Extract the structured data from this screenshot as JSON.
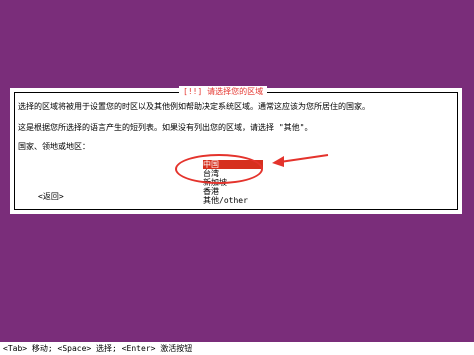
{
  "dialog": {
    "title": "[!!] 请选择您的区域",
    "description_line1": "选择的区域将被用于设置您的时区以及其他例如帮助决定系统区域。通常这应该为您所居住的国家。",
    "description_line2": "这是根据您所选择的语言产生的短列表。如果没有列出您的区域，请选择 \"其他\"。",
    "field_label": "国家、领地或地区：",
    "options": [
      "中国",
      "台湾",
      "新加坡",
      "香港",
      "其他/other"
    ],
    "selected_option": "中国",
    "back_label": "<返回>"
  },
  "statusbar": {
    "text": "<Tab> 移动; <Space> 选择; <Enter> 激活按钮"
  },
  "colors": {
    "background": "#7a2d7a",
    "dialog_background": "#ffffff",
    "title": "#e4332c",
    "selection": "#d6301e",
    "annotation": "#e4332c"
  }
}
